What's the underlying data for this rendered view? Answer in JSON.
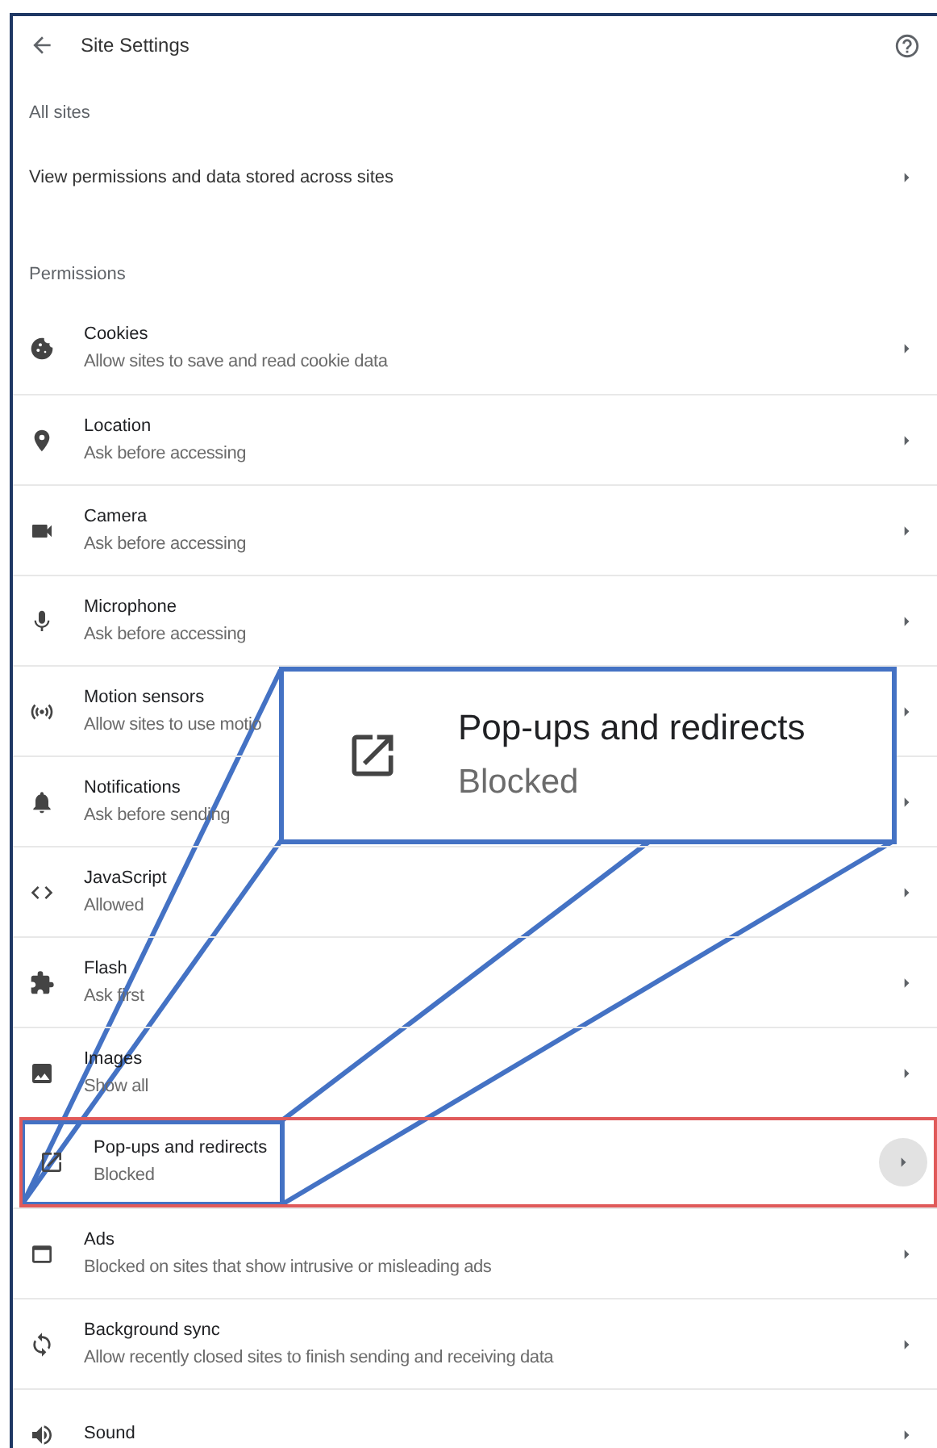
{
  "header": {
    "title": "Site Settings"
  },
  "all_sites": {
    "label": "All sites",
    "link": "View permissions and data stored across sites"
  },
  "permissions": {
    "label": "Permissions",
    "items": [
      {
        "title": "Cookies",
        "subtitle": "Allow sites to save and read cookie data",
        "hovered": false,
        "highlighted": false
      },
      {
        "title": "Location",
        "subtitle": "Ask before accessing",
        "hovered": false,
        "highlighted": false
      },
      {
        "title": "Camera",
        "subtitle": "Ask before accessing",
        "hovered": false,
        "highlighted": false
      },
      {
        "title": "Microphone",
        "subtitle": "Ask before accessing",
        "hovered": false,
        "highlighted": false
      },
      {
        "title": "Motion sensors",
        "subtitle": "Allow sites to use motio",
        "hovered": false,
        "highlighted": false
      },
      {
        "title": "Notifications",
        "subtitle": "Ask before sending",
        "hovered": false,
        "highlighted": false
      },
      {
        "title": "JavaScript",
        "subtitle": "Allowed",
        "hovered": false,
        "highlighted": false
      },
      {
        "title": "Flash",
        "subtitle": "Ask first",
        "hovered": false,
        "highlighted": false
      },
      {
        "title": "Images",
        "subtitle": "Show all",
        "hovered": false,
        "highlighted": false
      },
      {
        "title": "Pop-ups and redirects",
        "subtitle": "Blocked",
        "hovered": true,
        "highlighted": true
      },
      {
        "title": "Ads",
        "subtitle": "Blocked on sites that show intrusive or misleading ads",
        "hovered": false,
        "highlighted": false
      },
      {
        "title": "Background sync",
        "subtitle": "Allow recently closed sites to finish sending and receiving data",
        "hovered": false,
        "highlighted": false
      },
      {
        "title": "Sound",
        "hovered": false,
        "highlighted": false
      }
    ]
  },
  "callout": {
    "title": "Pop-ups and redirects",
    "subtitle": "Blocked"
  }
}
